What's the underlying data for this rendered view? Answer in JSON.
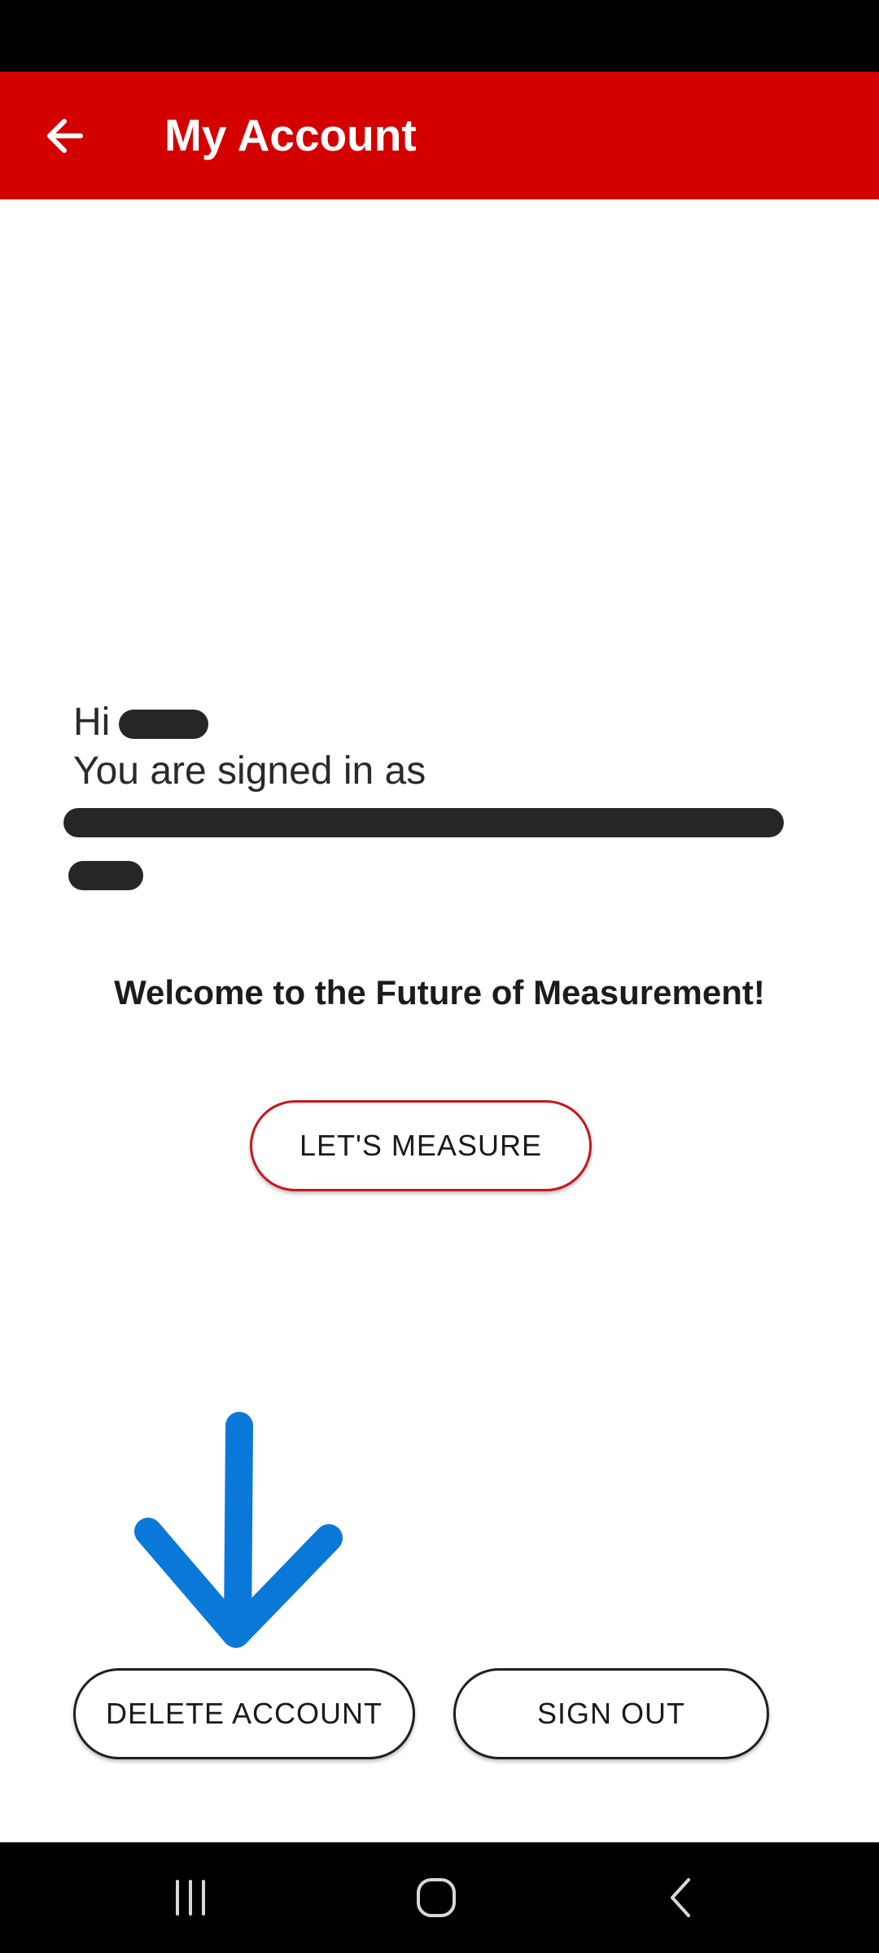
{
  "app_bar": {
    "title": "My Account",
    "back_icon": "arrow-left-icon",
    "color": "#d40000"
  },
  "account": {
    "greeting": "Hi",
    "signed_in_label": "You are signed in as"
  },
  "welcome_text": "Welcome to the Future of Measurement!",
  "buttons": {
    "measure": "LET'S MEASURE",
    "delete_account": "DELETE ACCOUNT",
    "sign_out": "SIGN OUT"
  },
  "annotation": {
    "icon": "arrow-down-icon",
    "color": "#0a78d8"
  },
  "nav_bar": {
    "icons": [
      "recent-apps-icon",
      "home-icon",
      "back-icon"
    ]
  }
}
